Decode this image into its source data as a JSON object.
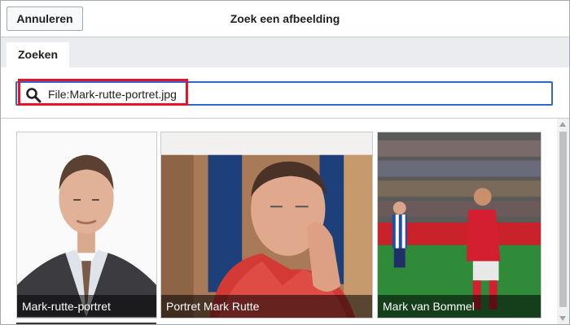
{
  "header": {
    "cancel_label": "Annuleren",
    "title": "Zoek een afbeelding"
  },
  "tabs": [
    {
      "label": "Zoeken"
    }
  ],
  "search": {
    "value": "File:Mark-rutte-portret.jpg",
    "placeholder": ""
  },
  "results": [
    {
      "caption": "Mark-rutte-portret"
    },
    {
      "caption": "Portret Mark Rutte"
    },
    {
      "caption": "Mark van Bommel"
    }
  ],
  "colors": {
    "accent": "#3366cc",
    "highlight": "#e8122a",
    "tab_bar": "#eaecf0"
  }
}
